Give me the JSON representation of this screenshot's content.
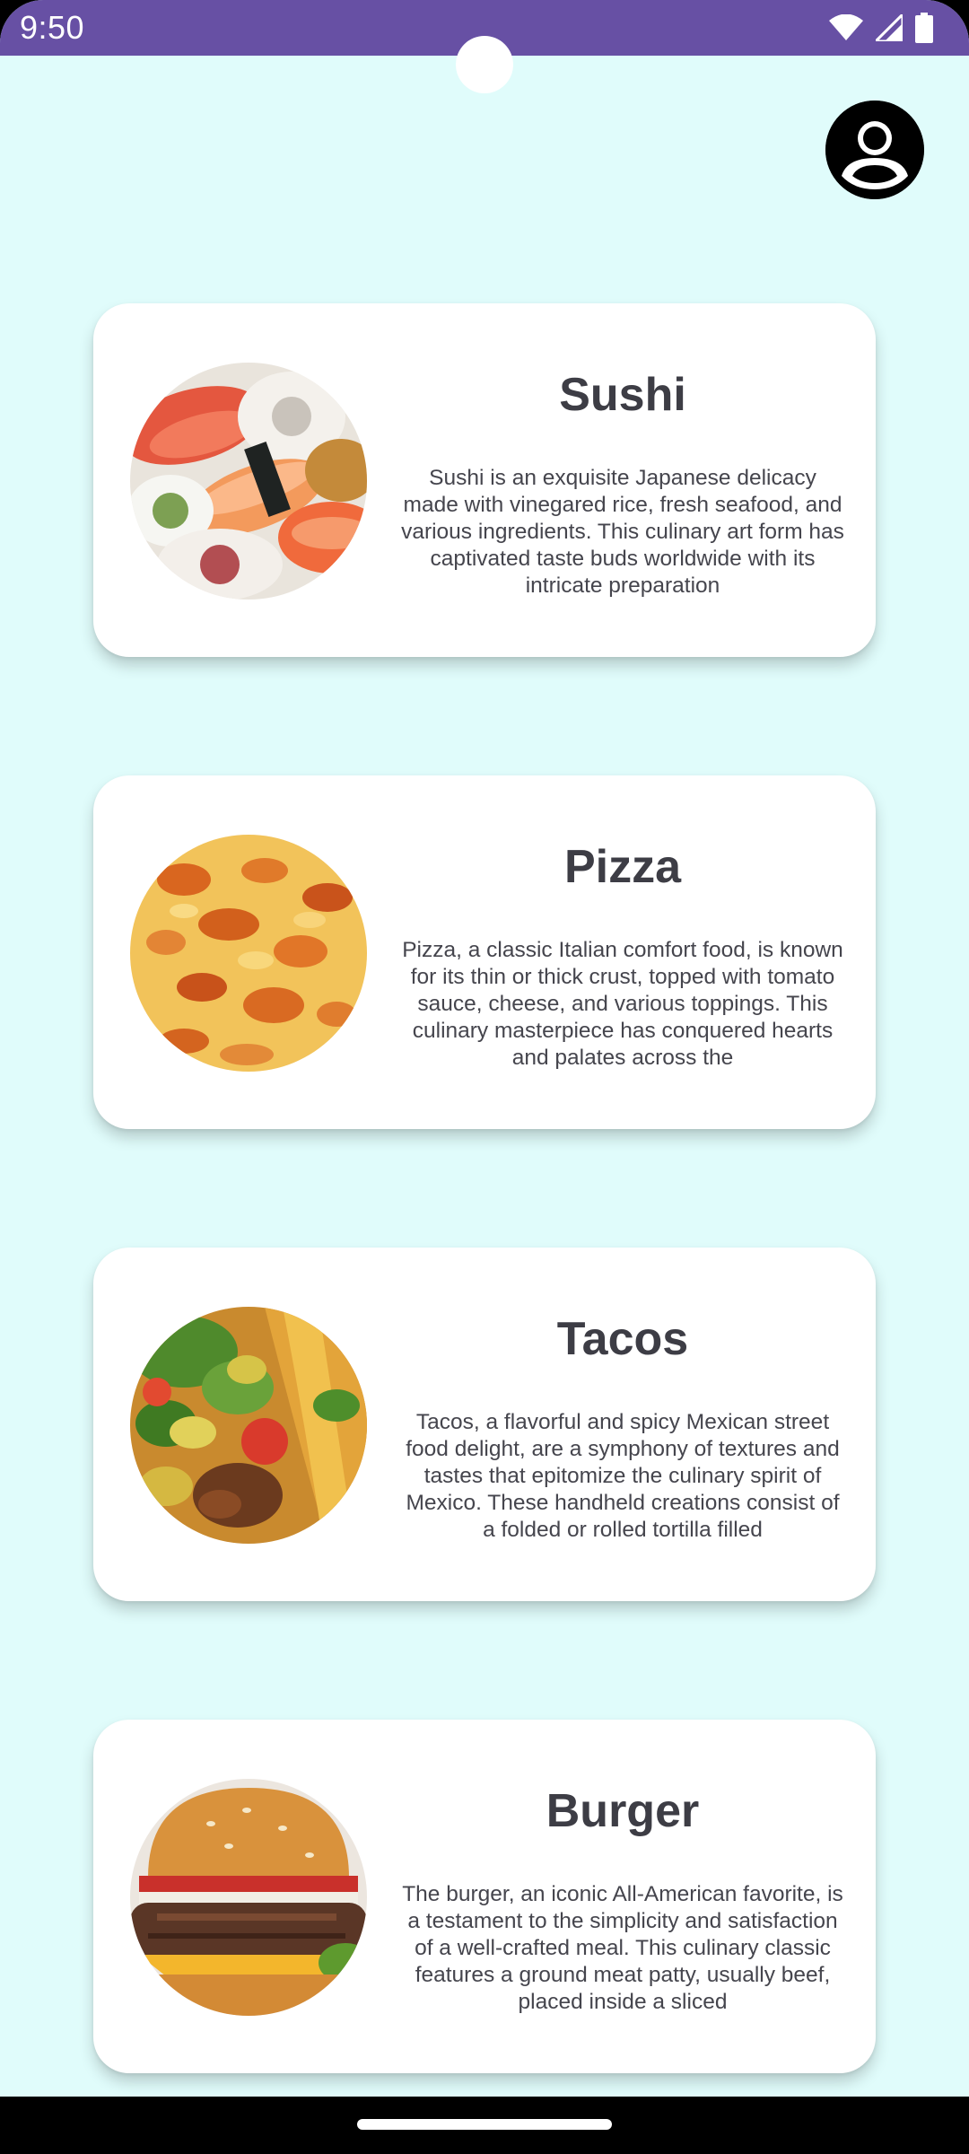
{
  "status_bar": {
    "time": "9:50",
    "background_color": "#6750a4",
    "icons": [
      "wifi-icon",
      "cellular-signal-icon",
      "battery-icon"
    ]
  },
  "header": {
    "profile_icon": "account-circle-icon"
  },
  "colors": {
    "screen_background": "#e0fcfb",
    "card_background": "#ffffff",
    "title_text": "#3d3d45"
  },
  "foods": [
    {
      "name": "Sushi",
      "image": "sushi-photo",
      "description": "Sushi is an exquisite Japanese delicacy made with vinegared rice, fresh seafood, and various ingredients. This culinary art form has captivated taste buds worldwide with its intricate preparation"
    },
    {
      "name": "Pizza",
      "image": "pizza-photo",
      "description": "Pizza, a classic Italian comfort food, is known for its thin or thick crust, topped with tomato sauce, cheese, and various toppings. This culinary masterpiece has conquered hearts and palates across the"
    },
    {
      "name": "Tacos",
      "image": "tacos-photo",
      "description": "Tacos, a flavorful and spicy Mexican street food delight, are a symphony of textures and tastes that epitomize the culinary spirit of Mexico. These handheld creations consist of a folded or rolled tortilla filled"
    },
    {
      "name": "Burger",
      "image": "burger-photo",
      "description": "The burger, an iconic All-American favorite, is a testament to the simplicity and satisfaction of a well-crafted meal. This culinary classic features a ground meat patty, usually beef, placed inside a sliced"
    }
  ]
}
